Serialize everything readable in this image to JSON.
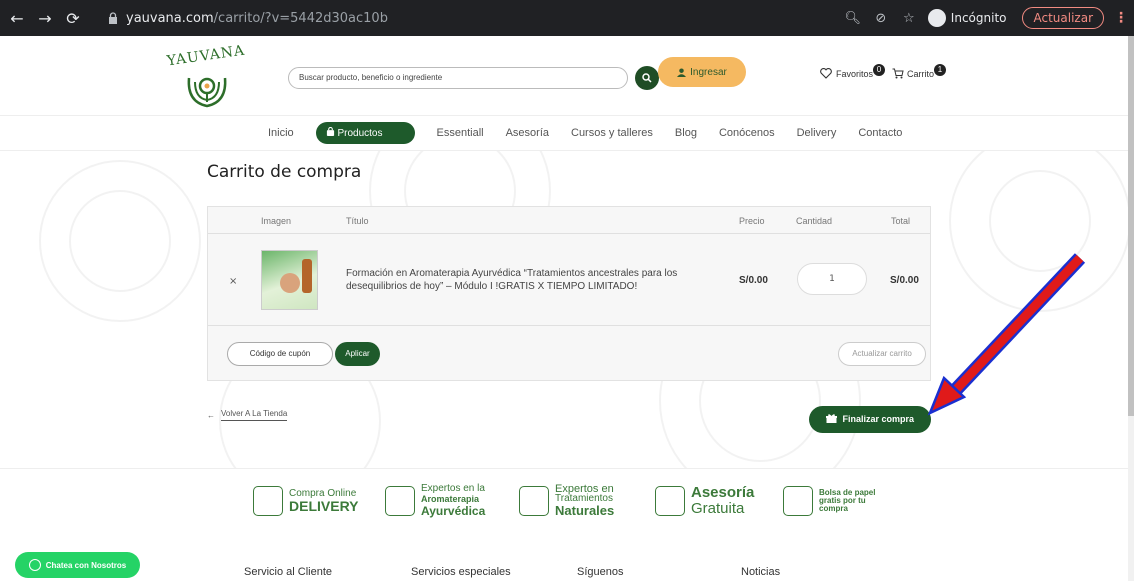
{
  "browser": {
    "url_domain": "yauvana.com",
    "url_path": "/carrito/?v=5442d30ac10b",
    "incognito_label": "Incógnito",
    "update_label": "Actualizar"
  },
  "header": {
    "logo_text": "YAUVANA",
    "search_placeholder": "Buscar producto, beneficio o ingrediente",
    "login_label": "Ingresar",
    "favorites_label": "Favoritos",
    "favorites_count": "0",
    "cart_label": "Carrito",
    "cart_count": "1"
  },
  "nav": {
    "items": [
      "Inicio",
      "Productos",
      "Essentiall",
      "Asesoría",
      "Cursos y talleres",
      "Blog",
      "Conócenos",
      "Delivery",
      "Contacto"
    ]
  },
  "page": {
    "title": "Carrito de compra"
  },
  "cart": {
    "headers": {
      "image": "Imagen",
      "title": "Título",
      "price": "Precio",
      "quantity": "Cantidad",
      "total": "Total"
    },
    "item": {
      "remove": "×",
      "title": "Formación en Aromaterapia Ayurvédica “Tratamientos ancestrales para los desequilibrios de hoy” – Módulo I !GRATIS X TIEMPO LIMITADO!",
      "price": "S/0.00",
      "quantity": "1",
      "total": "S/0.00"
    },
    "coupon_placeholder": "Código de cupón",
    "apply_label": "Aplicar",
    "update_label": "Actualizar carrito"
  },
  "actions": {
    "back_label": "Volver A La Tienda",
    "checkout_label": "Finalizar compra"
  },
  "features": [
    {
      "line1": "Compra Online",
      "line2": "DELIVERY"
    },
    {
      "line1": "Expertos en la",
      "line2a": "Aromaterapia",
      "line2b": "Ayurvédica"
    },
    {
      "line1": "Expertos en",
      "line2a": "Tratamientos",
      "line2b": "Naturales"
    },
    {
      "line1": "Asesoría",
      "line2": "Gratuita"
    },
    {
      "line1": "Bolsa de papel",
      "line2": "gratis por tu",
      "line3": "compra"
    }
  ],
  "chat": {
    "label": "Chatea con Nosotros"
  },
  "footer": {
    "col1": "Servicio al Cliente",
    "col2": "Servicios especiales",
    "col3": "Síguenos",
    "col4": "Noticias"
  },
  "colors": {
    "brand_green": "#1e5a2b",
    "accent_orange": "#f5b961",
    "arrow_red": "#e01a1a",
    "arrow_blue": "#1a2fd0"
  }
}
